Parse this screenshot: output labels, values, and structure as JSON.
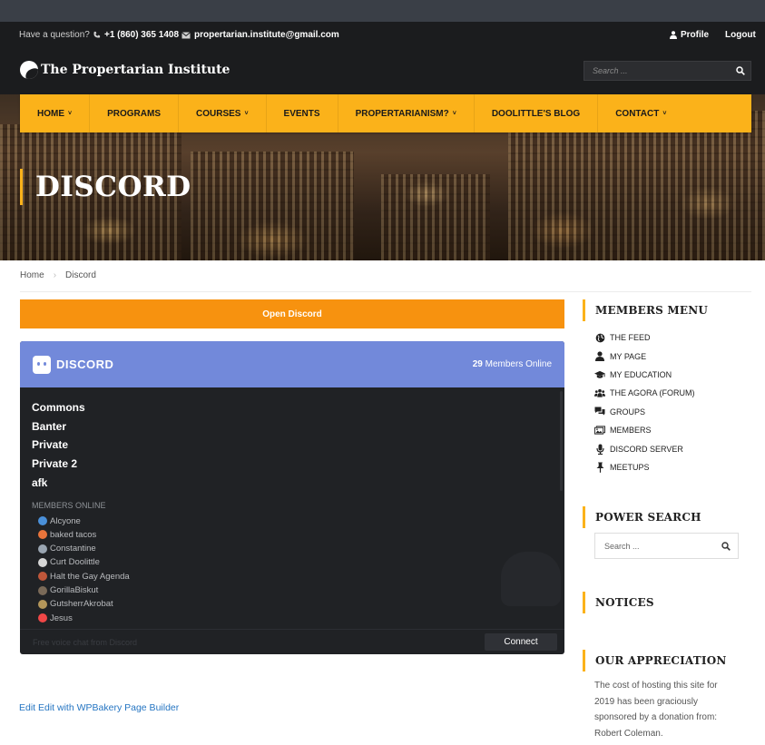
{
  "topbar": {
    "question": "Have a question?",
    "phone": "+1 (860) 365 1408",
    "email": "propertarian.institute@gmail.com",
    "profile": "Profile",
    "logout": "Logout"
  },
  "header": {
    "site_name": "The Propertarian Institute",
    "search_placeholder": "Search ..."
  },
  "nav": {
    "items": [
      {
        "label": "HOME",
        "dropdown": "˅"
      },
      {
        "label": "PROGRAMS",
        "dropdown": ""
      },
      {
        "label": "COURSES",
        "dropdown": "˅"
      },
      {
        "label": "EVENTS",
        "dropdown": ""
      },
      {
        "label": "PROPERTARIANISM?",
        "dropdown": "˅"
      },
      {
        "label": "DOOLITTLE'S BLOG",
        "dropdown": ""
      },
      {
        "label": "CONTACT",
        "dropdown": "˅"
      }
    ]
  },
  "hero": {
    "title": "DISCORD"
  },
  "breadcrumb": {
    "home": "Home",
    "sep": "›",
    "current": "Discord"
  },
  "main": {
    "open_discord": "Open Discord",
    "edit_link": "Edit Edit with WPBakery Page Builder"
  },
  "discord": {
    "brand": "DISCORD",
    "online_count": "29",
    "online_label": "Members Online",
    "channels": [
      "Commons",
      "Banter",
      "Private",
      "Private 2",
      "afk"
    ],
    "members_label": "MEMBERS ONLINE",
    "members": [
      {
        "name": "Alcyone",
        "color": "#4a90d9"
      },
      {
        "name": "baked tacos",
        "color": "#e8743b"
      },
      {
        "name": "Constantine",
        "color": "#9aa5b1"
      },
      {
        "name": "Curt Doolittle",
        "color": "#d6d6d6"
      },
      {
        "name": "Halt the Gay Agenda",
        "color": "#c0573a"
      },
      {
        "name": "GorillaBiskut",
        "color": "#7a6a58"
      },
      {
        "name": "GutsherrAkrobat",
        "color": "#b3965a"
      },
      {
        "name": "Jesus",
        "color": "#f04747"
      }
    ],
    "footer_text": "Free voice chat from Discord",
    "connect": "Connect"
  },
  "sidebar": {
    "members_menu_title": "MEMBERS MENU",
    "menu": [
      {
        "label": "THE FEED",
        "icon": "globe-icon"
      },
      {
        "label": "MY PAGE",
        "icon": "user-icon"
      },
      {
        "label": "MY EDUCATION",
        "icon": "graduation-cap-icon"
      },
      {
        "label": "THE AGORA (FORUM)",
        "icon": "users-icon"
      },
      {
        "label": "GROUPS",
        "icon": "comments-icon"
      },
      {
        "label": "MEMBERS",
        "icon": "images-icon"
      },
      {
        "label": "DISCORD SERVER",
        "icon": "microphone-icon"
      },
      {
        "label": "MEETUPS",
        "icon": "pin-icon"
      }
    ],
    "power_search_title": "POWER SEARCH",
    "search_placeholder": "Search ...",
    "notices_title": "NOTICES",
    "appreciation_title": "OUR APPRECIATION",
    "appreciation_text": "The cost of hosting this site for 2019 has been graciously sponsored by a donation from: Robert Coleman."
  },
  "colors": {
    "accent": "#fbb21a",
    "button_orange": "#f7920f",
    "discord_blurple": "#7289da",
    "discord_dark": "#202225",
    "link": "#2575c2"
  }
}
